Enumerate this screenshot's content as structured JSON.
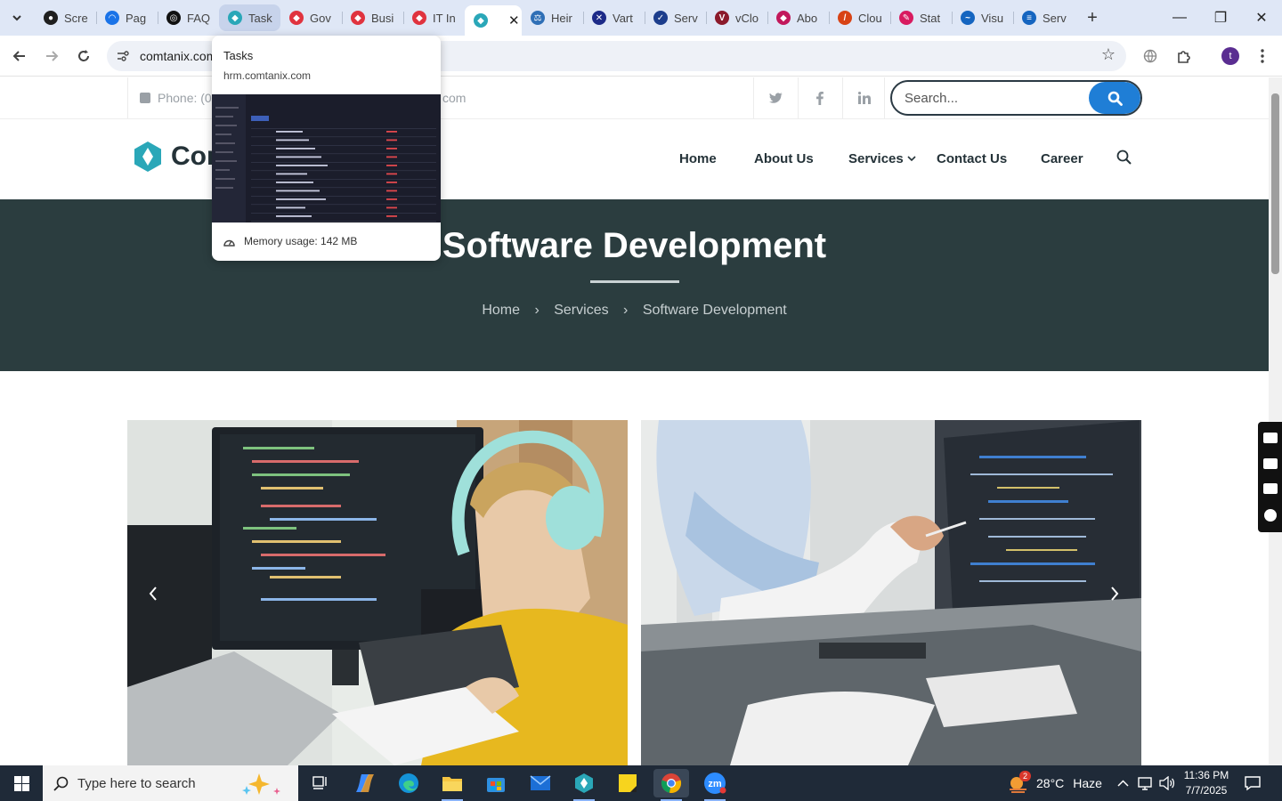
{
  "browser": {
    "tabs": [
      {
        "title": "Scre",
        "color": "#1f1f1f",
        "glyph": "●"
      },
      {
        "title": "Pag",
        "color": "#1a73e8",
        "glyph": "◠"
      },
      {
        "title": "FAQ",
        "color": "#111111",
        "glyph": "◎"
      },
      {
        "title": "Task",
        "color": "#2aa7b8",
        "glyph": "◆"
      },
      {
        "title": "Gov",
        "color": "#e0333f",
        "glyph": "◆"
      },
      {
        "title": "Busi",
        "color": "#e0333f",
        "glyph": "◆"
      },
      {
        "title": "IT In",
        "color": "#e0333f",
        "glyph": "◆"
      },
      {
        "title": "",
        "color": "#2aa7b8",
        "glyph": "◆"
      },
      {
        "title": "Heir",
        "color": "#2f6fb6",
        "glyph": "⚖"
      },
      {
        "title": "Vart",
        "color": "#1c2a88",
        "glyph": "✕"
      },
      {
        "title": "Serv",
        "color": "#1c3d8c",
        "glyph": "✓"
      },
      {
        "title": "vClo",
        "color": "#8b1a2b",
        "glyph": "V"
      },
      {
        "title": "Abo",
        "color": "#c2185b",
        "glyph": "◆"
      },
      {
        "title": "Clou",
        "color": "#d84315",
        "glyph": "/"
      },
      {
        "title": "Stat",
        "color": "#d81b60",
        "glyph": "✎"
      },
      {
        "title": "Visu",
        "color": "#1565c0",
        "glyph": "~"
      },
      {
        "title": "Serv",
        "color": "#1565c0",
        "glyph": "≡"
      }
    ],
    "active_tab_close": "✕",
    "new_tab": "+",
    "window_controls": {
      "minimize": "—",
      "maximize": "❐",
      "close": "✕"
    },
    "url": "comtanix.com",
    "profile_initial": "t",
    "icons": {
      "back": "arrow-left-icon",
      "forward": "arrow-right-icon",
      "reload": "reload-icon",
      "bookmark": "star-icon"
    }
  },
  "hover_card": {
    "title": "Tasks",
    "domain": "hrm.comtanix.com",
    "memory": "Memory usage: 142 MB"
  },
  "site": {
    "phone": "Phone: (0",
    "email_tail": "com",
    "search_placeholder": "Search...",
    "logo_text": "Cor",
    "nav": [
      "Home",
      "About Us",
      "Services",
      "Contact Us",
      "Career"
    ],
    "hero_title": "Software Development",
    "breadcrumb": [
      "Home",
      "Services",
      "Software Development"
    ],
    "colors": {
      "hero_bg": "#2b3d3f",
      "accent": "#1f7ed6",
      "logo": "#2aa7b8",
      "heading": "#243238"
    }
  },
  "taskbar": {
    "search_placeholder": "Type here to search",
    "weather_temp": "28°C",
    "weather_text": "Haze",
    "weather_badge": "2",
    "time": "11:36 PM",
    "date": "7/7/2025"
  }
}
